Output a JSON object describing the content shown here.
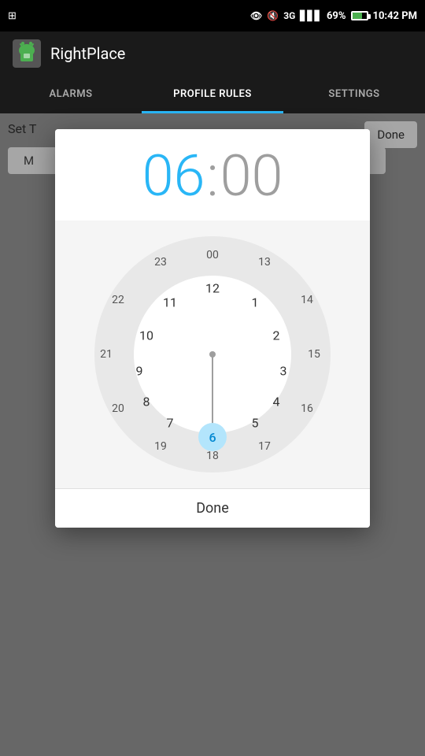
{
  "statusBar": {
    "time": "10:42 PM",
    "battery": "69%",
    "signal": "3G"
  },
  "appHeader": {
    "title": "RightPlace"
  },
  "tabs": [
    {
      "label": "ALARMS",
      "active": false
    },
    {
      "label": "PROFILE RULES",
      "active": true
    },
    {
      "label": "SETTINGS",
      "active": false
    }
  ],
  "bgContent": {
    "setTimeLabel": "Set T",
    "doneLabel": "Done",
    "mLabel": "M"
  },
  "dialog": {
    "hours": "06",
    "colon": ":",
    "minutes": "00",
    "doneLabel": "Done",
    "selectedNumber": "6",
    "clockNumbers": {
      "outer": [
        "00",
        "13",
        "14",
        "15",
        "16",
        "17",
        "18",
        "19",
        "20",
        "21",
        "22",
        "23"
      ],
      "inner": [
        "12",
        "1",
        "2",
        "3",
        "4",
        "5",
        "6",
        "7",
        "8",
        "9",
        "10",
        "11"
      ]
    }
  },
  "colors": {
    "accent": "#29b6f6",
    "selectedBg": "#b3e5fc",
    "selectedText": "#0288d1"
  }
}
